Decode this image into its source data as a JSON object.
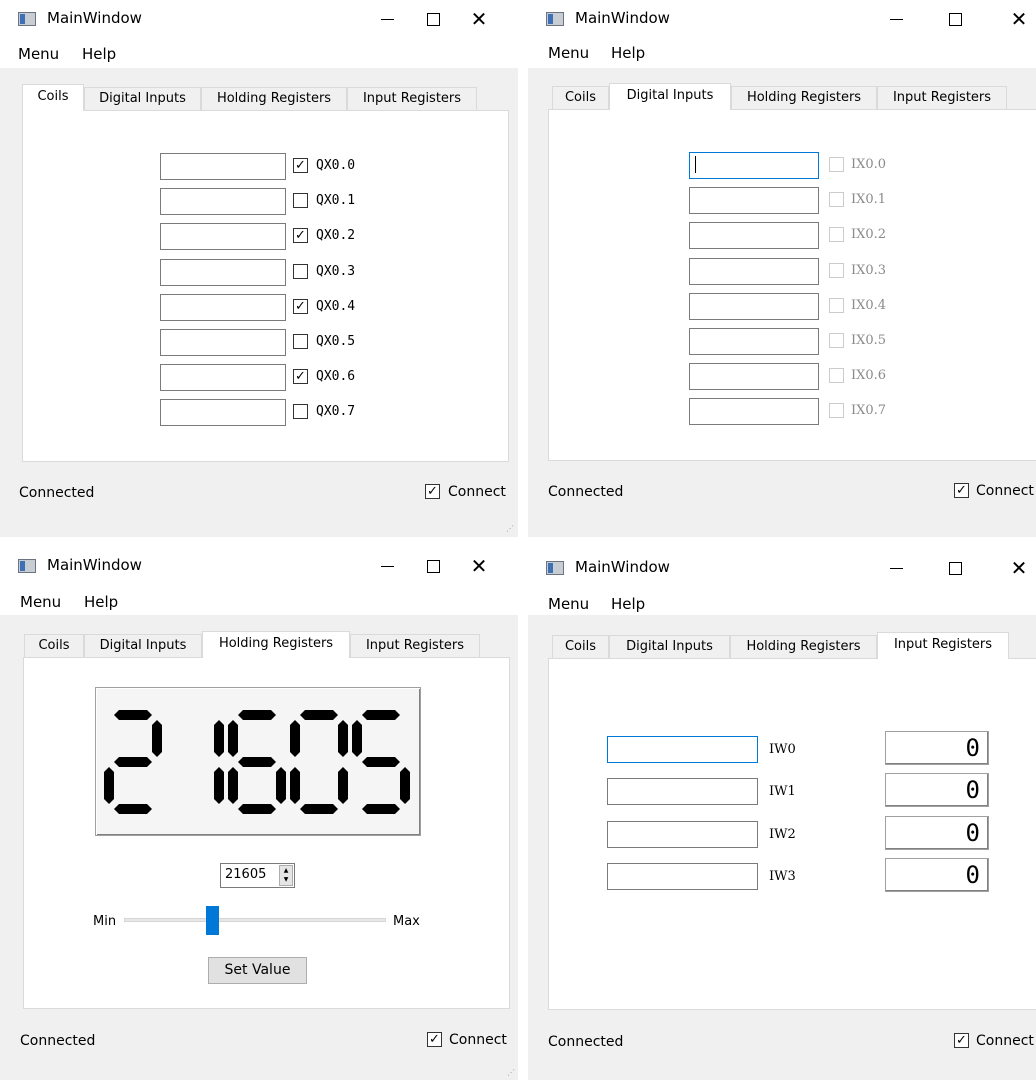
{
  "window_title": "MainWindow",
  "menu": [
    "Menu",
    "Help"
  ],
  "tabs": [
    "Coils",
    "Digital Inputs",
    "Holding Registers",
    "Input Registers"
  ],
  "status": "Connected",
  "connect_label": "Connect",
  "connect_checked": true,
  "coils": {
    "items": [
      {
        "label": "QX0.0",
        "checked": true
      },
      {
        "label": "QX0.1",
        "checked": false
      },
      {
        "label": "QX0.2",
        "checked": true
      },
      {
        "label": "QX0.3",
        "checked": false
      },
      {
        "label": "QX0.4",
        "checked": true
      },
      {
        "label": "QX0.5",
        "checked": false
      },
      {
        "label": "QX0.6",
        "checked": true
      },
      {
        "label": "QX0.7",
        "checked": false
      }
    ]
  },
  "digital_inputs": {
    "items": [
      {
        "label": "IX0.0",
        "checked": false
      },
      {
        "label": "IX0.1",
        "checked": false
      },
      {
        "label": "IX0.2",
        "checked": false
      },
      {
        "label": "IX0.3",
        "checked": false
      },
      {
        "label": "IX0.4",
        "checked": false
      },
      {
        "label": "IX0.5",
        "checked": false
      },
      {
        "label": "IX0.6",
        "checked": false
      },
      {
        "label": "IX0.7",
        "checked": false
      }
    ]
  },
  "holding_registers": {
    "lcd_value": "21605",
    "spin_value": "21605",
    "slider_min_label": "Min",
    "slider_max_label": "Max",
    "slider_fraction": 0.33,
    "set_button": "Set Value"
  },
  "input_registers": {
    "items": [
      {
        "label": "IW0",
        "value": "0"
      },
      {
        "label": "IW1",
        "value": "0"
      },
      {
        "label": "IW2",
        "value": "0"
      },
      {
        "label": "IW3",
        "value": "0"
      }
    ]
  }
}
